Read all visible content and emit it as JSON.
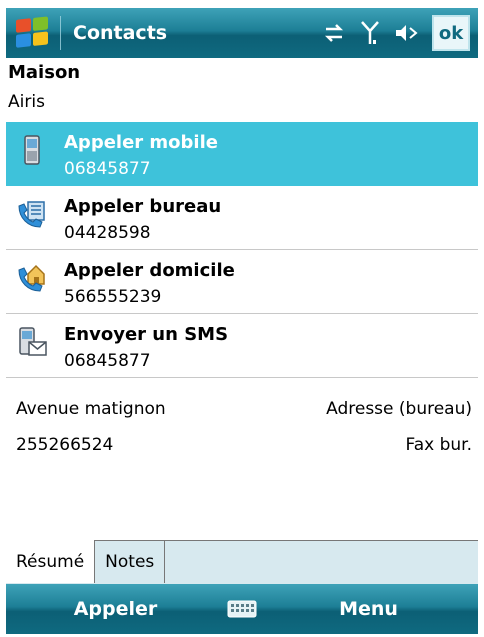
{
  "titlebar": {
    "title": "Contacts",
    "ok_label": "ok"
  },
  "contact": {
    "name": "Maison",
    "company": "Airis"
  },
  "actions": [
    {
      "label": "Appeler mobile",
      "number": "06845877",
      "icon": "mobile-phone-icon",
      "selected": true
    },
    {
      "label": "Appeler bureau",
      "number": "04428598",
      "icon": "office-phone-icon",
      "selected": false
    },
    {
      "label": "Appeler domicile",
      "number": "566555239",
      "icon": "home-phone-icon",
      "selected": false
    },
    {
      "label": "Envoyer un SMS",
      "number": "06845877",
      "icon": "sms-icon",
      "selected": false
    }
  ],
  "details": [
    {
      "value": "Avenue matignon",
      "type": "Adresse (bureau)"
    },
    {
      "value": "255266524",
      "type": "Fax bur."
    }
  ],
  "tabs": [
    "Résumé",
    "Notes"
  ],
  "menubar": {
    "left": "Appeler",
    "right": "Menu"
  },
  "colors": {
    "selection": "#3ec2da",
    "bar": "#1d7f96"
  }
}
